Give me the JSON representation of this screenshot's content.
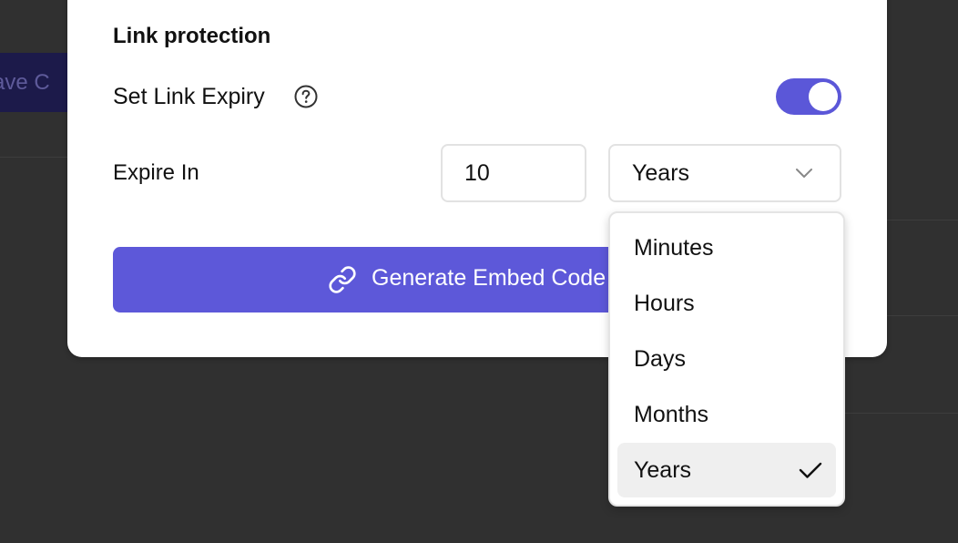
{
  "background": {
    "partial_button_text": "ave C"
  },
  "modal": {
    "section_title": "Link protection",
    "expiry": {
      "label": "Set Link Expiry",
      "help_icon": "question-circle-icon",
      "enabled": true
    },
    "expire_in": {
      "label": "Expire In",
      "value": "10",
      "unit": "Years"
    },
    "generate_button": {
      "icon": "link-icon",
      "label": "Generate Embed Code"
    }
  },
  "dropdown": {
    "options": [
      {
        "label": "Minutes"
      },
      {
        "label": "Hours"
      },
      {
        "label": "Days"
      },
      {
        "label": "Months"
      },
      {
        "label": "Years"
      }
    ],
    "selected": "Years"
  },
  "colors": {
    "accent": "#5d58d9",
    "backdrop": "#303030"
  }
}
